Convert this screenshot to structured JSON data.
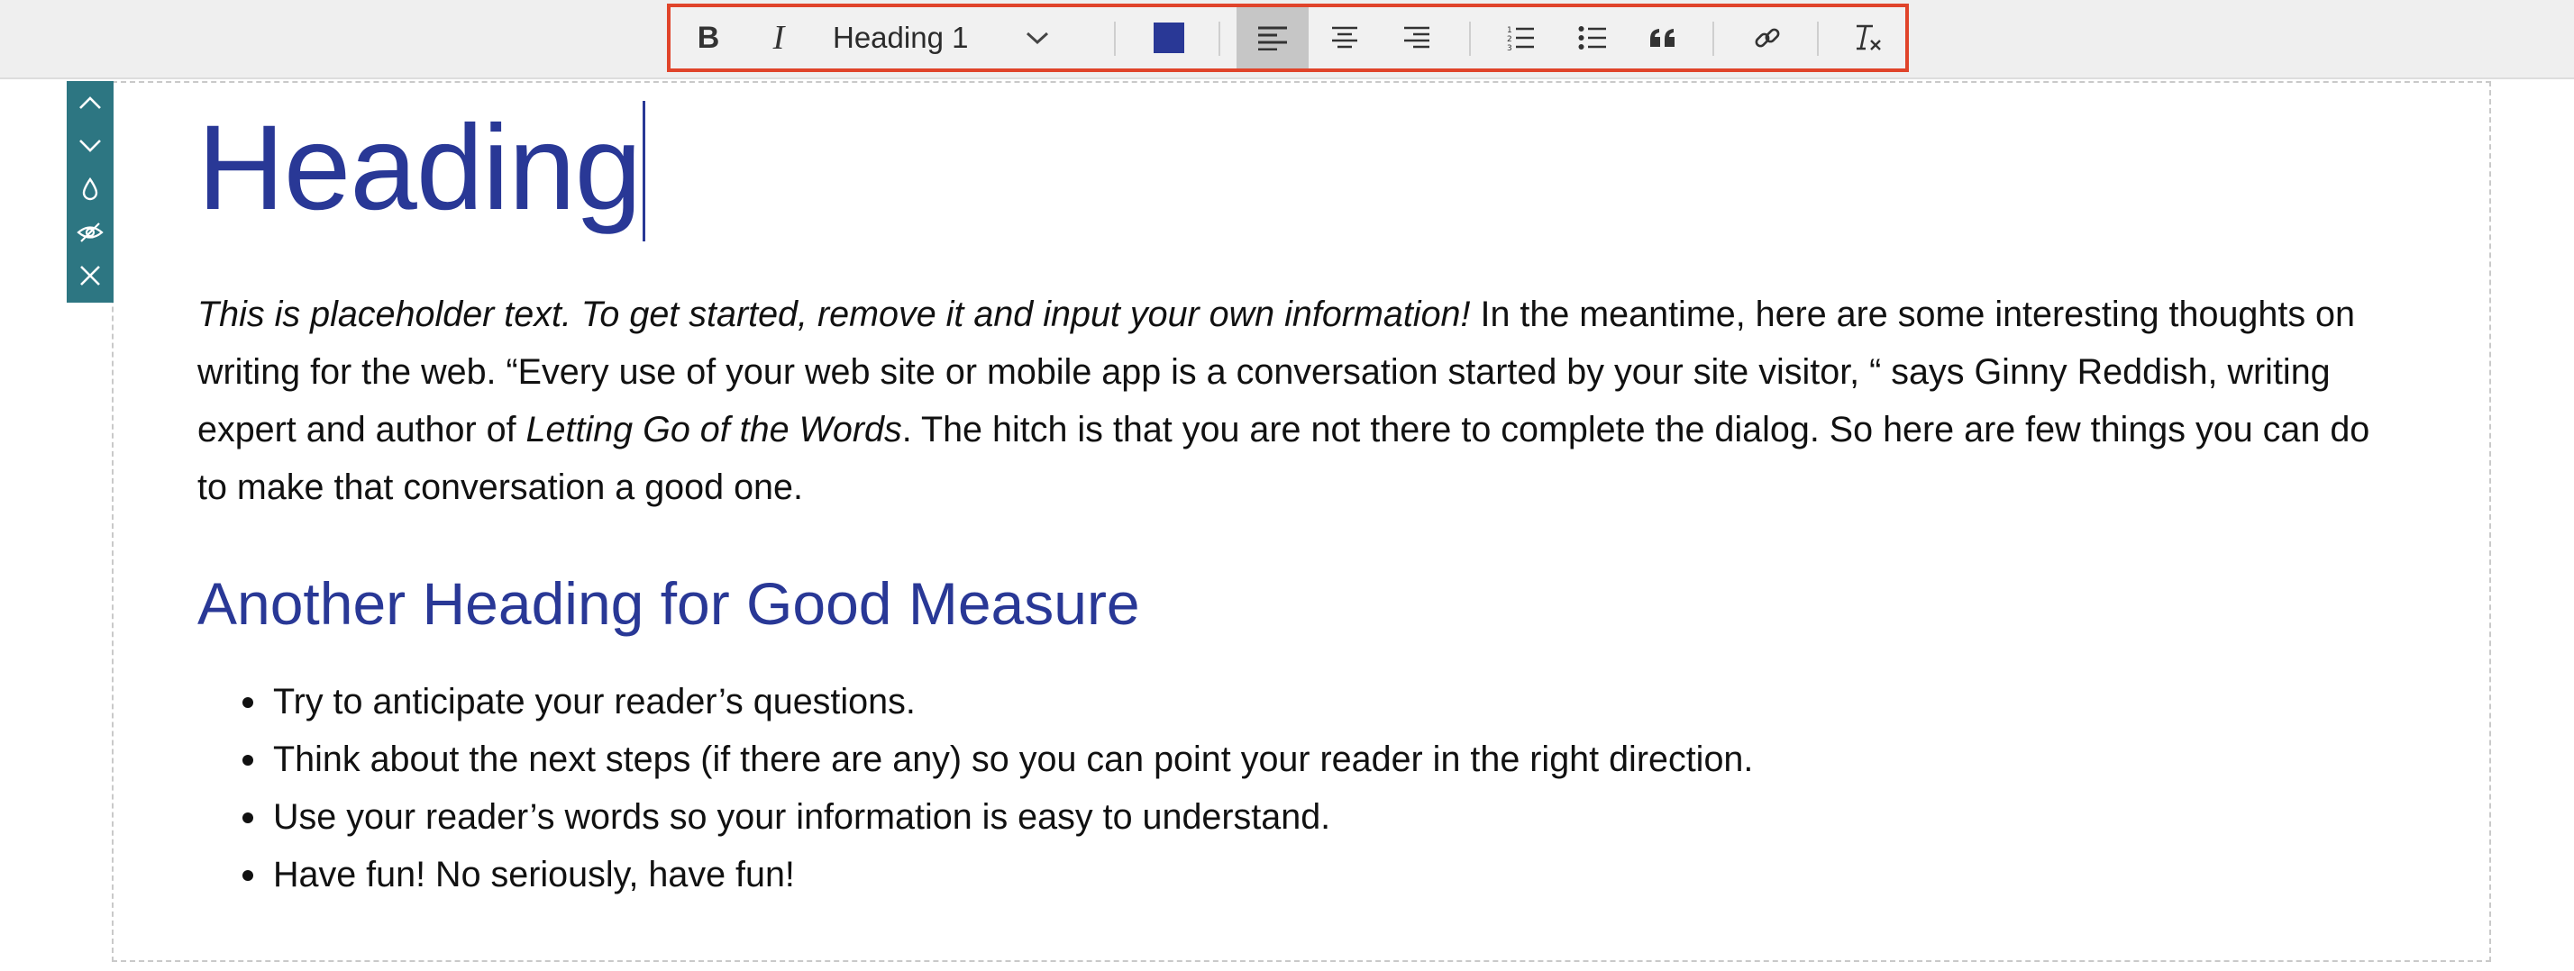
{
  "toolbar": {
    "bold_label": "B",
    "italic_label": "I",
    "block_format": "Heading 1",
    "text_color": "#293896",
    "highlight_color": "#e0442a",
    "buttons": [
      "bold-icon",
      "italic-icon",
      "block-format-dropdown",
      "text-color-swatch",
      "align-left-icon",
      "align-center-icon",
      "align-right-icon",
      "numbered-list-icon",
      "bulleted-list-icon",
      "blockquote-icon",
      "link-icon",
      "clear-formatting-icon"
    ]
  },
  "side_toolbar": {
    "buttons": [
      "chevron-up-icon",
      "chevron-down-icon",
      "drop-icon",
      "eye-off-icon",
      "close-icon"
    ],
    "color": "#2d7682"
  },
  "content": {
    "heading": "Heading",
    "paragraph": {
      "italic_intro": "This is placeholder text. To get started, remove it and input your own information!",
      "text_1": " In the meantime, here are some interesting thoughts on writing for the web. “Every use of your web site or mobile app is a conversation started by your site visitor, “ says Ginny Reddish, writing expert and author of ",
      "book_title": "Letting Go of the Words",
      "text_2": ". The hitch is that you are not there to complete the dialog. So here are few things you can do to make that conversation a good one."
    },
    "subheading": "Another Heading for Good Measure",
    "list_items": [
      "Try to anticipate your reader’s questions.",
      "Think about the next steps (if there are any) so you can point your reader in the right direction.",
      "Use your reader’s words so your information is easy to understand.",
      "Have fun! No seriously, have fun!"
    ]
  }
}
